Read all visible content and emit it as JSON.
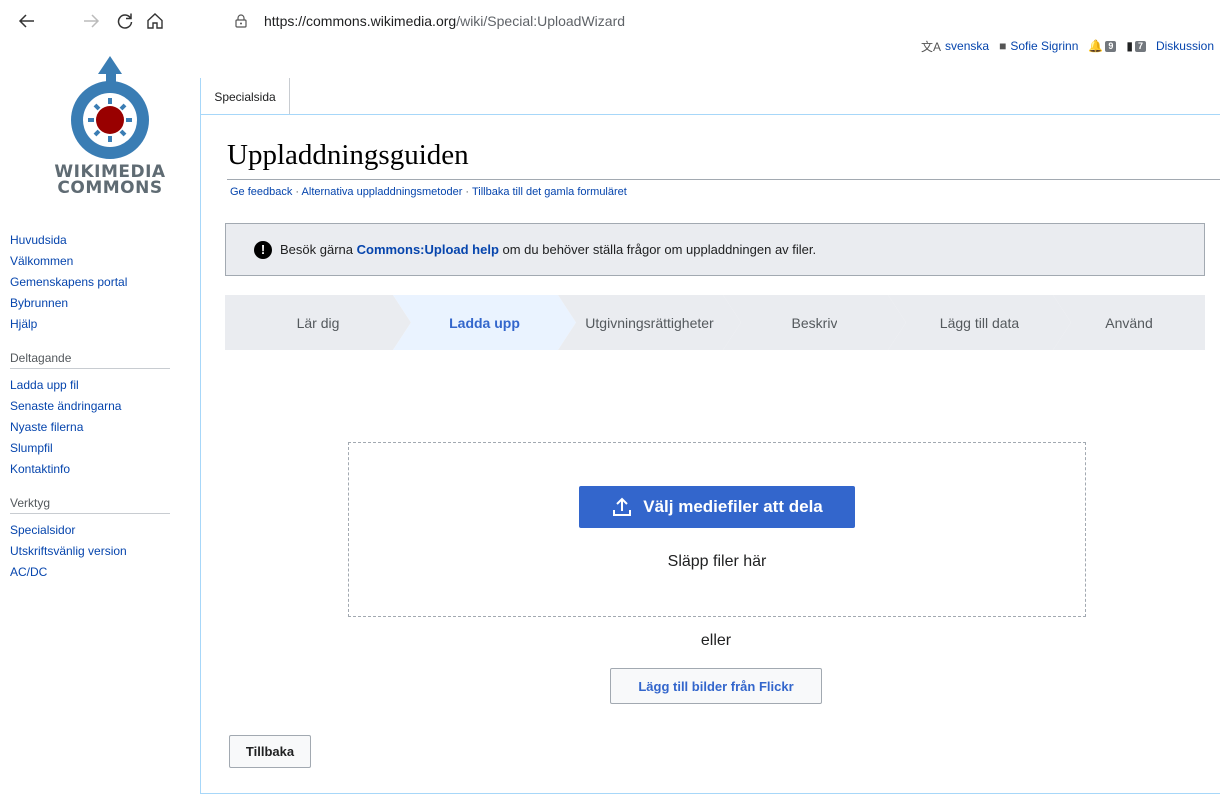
{
  "browser": {
    "url_host": "https://commons.wikimedia.org",
    "url_path": "/wiki/Special:UploadWizard"
  },
  "personal_tools": {
    "language": "svenska",
    "username": "Sofie Sigrinn",
    "alerts_count": "9",
    "notices_count": "7",
    "talk_label": "Diskussion"
  },
  "logo": {
    "line1": "WIKIMEDIA",
    "line2": "COMMONS"
  },
  "sidebar": {
    "main_links": [
      "Huvudsida",
      "Välkommen",
      "Gemenskapens portal",
      "Bybrunnen",
      "Hjälp"
    ],
    "participation_heading": "Deltagande",
    "participation_links": [
      "Ladda upp fil",
      "Senaste ändringarna",
      "Nyaste filerna",
      "Slumpfil",
      "Kontaktinfo"
    ],
    "tools_heading": "Verktyg",
    "tools_links": [
      "Specialsidor",
      "Utskriftsvänlig version",
      "AC/DC"
    ]
  },
  "tab": {
    "label": "Specialsida"
  },
  "page": {
    "title": "Uppladdningsguiden",
    "subnav": {
      "feedback": "Ge feedback",
      "alt_methods": "Alternativa uppladdningsmetoder",
      "old_form": "Tillbaka till det gamla formuläret",
      "separator": " · "
    },
    "notice": {
      "before": "Besök gärna ",
      "link": "Commons:Upload help",
      "after": " om du behöver ställa frågor om uppladdningen av filer."
    }
  },
  "steps": [
    {
      "label": "Lär dig"
    },
    {
      "label": "Ladda upp"
    },
    {
      "label": "Utgivningsrättigheter"
    },
    {
      "label": "Beskriv"
    },
    {
      "label": "Lägg till data"
    },
    {
      "label": "Använd"
    }
  ],
  "upload": {
    "choose_button": "Välj mediefiler att dela",
    "drop_text": "Släpp filer här",
    "or_text": "eller",
    "flickr_button": "Lägg till bilder från Flickr",
    "back_button": "Tillbaka"
  },
  "colors": {
    "link": "#0645ad",
    "accent": "#3366cc",
    "active_step_bg": "#eaf3ff",
    "step_bg": "#eaecf0"
  }
}
